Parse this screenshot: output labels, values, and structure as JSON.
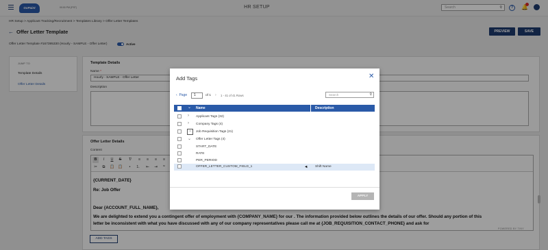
{
  "header": {
    "logo_text": "GoPaint",
    "time": "00:00 PM (PST)",
    "app_title": "HR SETUP",
    "search_placeholder": "Search",
    "help_icon": "help-circle-icon",
    "bell_icon": "bell-icon",
    "avatar_icon": "user-avatar-icon"
  },
  "breadcrumb": "HR Setup  >  Applicant Tracking/Recruitment  >  Templates Library  >  Offer Letter Templates",
  "page": {
    "title": "Offer Letter Template",
    "preview_label": "PREVIEW",
    "save_label": "SAVE",
    "subtitle": "Offer Letter Template #167395330 (Hourly - SAMPLE - Offer Letter)",
    "active_label": "Active"
  },
  "jump_to": {
    "title": "JUMP TO",
    "items": [
      "Template Details",
      "Offer Letter Details"
    ]
  },
  "template_details": {
    "title": "Template Details",
    "name_label": "Name",
    "name_value": "Hourly - SAMPLE - Offer Letter",
    "description_label": "Description"
  },
  "offer_details": {
    "title": "Offer Letter Details",
    "content_label": "Content",
    "lines": [
      "{CURRENT_DATE}",
      "Re: Job Offer",
      "Dear {ACCOUNT_FULL_NAME},",
      "We are delighted to extend you a contingent offer of employment with {COMPANY_NAME} for our . The information provided below outlines the details of our offer. Should any portion of this",
      "letter be inconsistent with what you have discussed with any of our company representatives please call me at {JOB_REQUISITION_CONTACT_PHONE} and ask for"
    ],
    "powered_by": "POWERED BY TINY",
    "add_tags_label": "ADD TAGS"
  },
  "modal": {
    "title": "Add Tags",
    "page_label": "Page",
    "page_value": "1",
    "of_label": "of 1",
    "rows_info": "1 - 41 of 41 Rows",
    "search_placeholder": "Search",
    "columns": [
      "Name",
      "Description"
    ],
    "rows": [
      {
        "label": "Applicant Tags (32)",
        "desc": "",
        "type": "group"
      },
      {
        "label": "Company Tags (4)",
        "desc": "",
        "type": "group"
      },
      {
        "label": "Job Requisition Tags (21)",
        "desc": "",
        "type": "group"
      },
      {
        "label": "Offer Letter Tags (4)",
        "desc": "",
        "type": "group-open"
      },
      {
        "label": "START_DATE",
        "desc": "",
        "type": "item"
      },
      {
        "label": "RATE",
        "desc": "",
        "type": "item"
      },
      {
        "label": "PER_PERIOD",
        "desc": "",
        "type": "item"
      },
      {
        "label": "OFFER_LETTER_CUSTOM_FIELD_1",
        "desc": "Shift Name",
        "type": "item"
      }
    ],
    "apply_label": "APPLY"
  }
}
